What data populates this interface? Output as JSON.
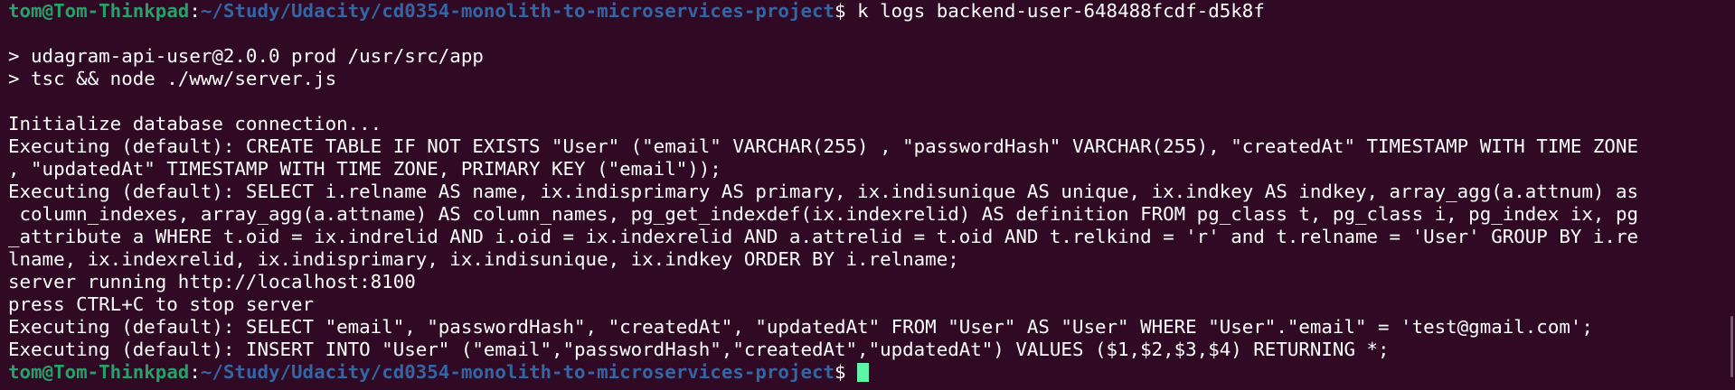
{
  "colors": {
    "background": "#300a24",
    "prompt_user": "#26a269",
    "prompt_path": "#3465a4",
    "cursor": "#5ff5a8",
    "text": "#ffffff"
  },
  "prompt": {
    "user_host": "tom@Tom-Thinkpad",
    "colon": ":",
    "path": "~/Study/Udacity/cd0354-monolith-to-microservices-project",
    "dollar": "$"
  },
  "command": " k logs backend-user-648488fcdf-d5k8f",
  "output_lines": [
    "",
    "> udagram-api-user@2.0.0 prod /usr/src/app",
    "> tsc && node ./www/server.js",
    "",
    "Initialize database connection...",
    "Executing (default): CREATE TABLE IF NOT EXISTS \"User\" (\"email\" VARCHAR(255) , \"passwordHash\" VARCHAR(255), \"createdAt\" TIMESTAMP WITH TIME ZONE",
    ", \"updatedAt\" TIMESTAMP WITH TIME ZONE, PRIMARY KEY (\"email\"));",
    "Executing (default): SELECT i.relname AS name, ix.indisprimary AS primary, ix.indisunique AS unique, ix.indkey AS indkey, array_agg(a.attnum) as",
    " column_indexes, array_agg(a.attname) AS column_names, pg_get_indexdef(ix.indexrelid) AS definition FROM pg_class t, pg_class i, pg_index ix, pg",
    "_attribute a WHERE t.oid = ix.indrelid AND i.oid = ix.indexrelid AND a.attrelid = t.oid AND t.relkind = 'r' and t.relname = 'User' GROUP BY i.re",
    "lname, ix.indexrelid, ix.indisprimary, ix.indisunique, ix.indkey ORDER BY i.relname;",
    "server running http://localhost:8100",
    "press CTRL+C to stop server",
    "Executing (default): SELECT \"email\", \"passwordHash\", \"createdAt\", \"updatedAt\" FROM \"User\" AS \"User\" WHERE \"User\".\"email\" = 'test@gmail.com';",
    "Executing (default): INSERT INTO \"User\" (\"email\",\"passwordHash\",\"createdAt\",\"updatedAt\") VALUES ($1,$2,$3,$4) RETURNING *;"
  ]
}
